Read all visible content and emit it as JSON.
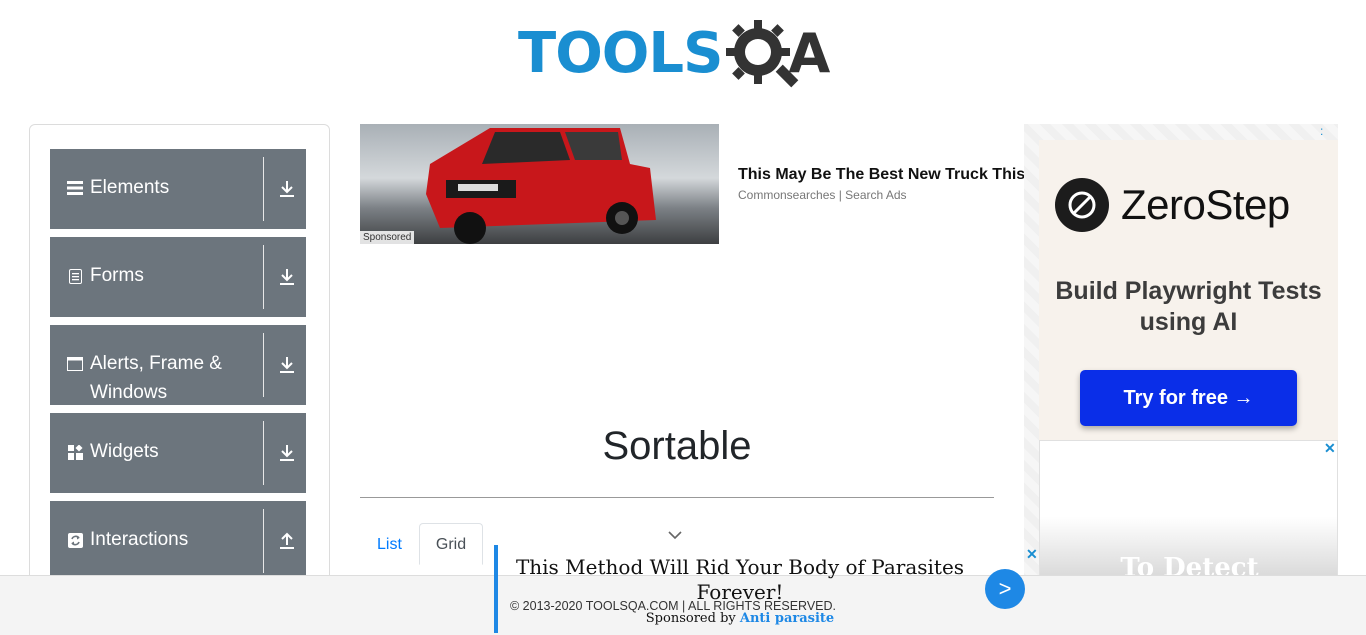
{
  "header": {
    "logo_text_main": "TOOLS",
    "logo_text_end": "A"
  },
  "sidebar": {
    "groups": [
      {
        "label": "Elements",
        "icon": "list-icon",
        "toggle_icon": "download-arrow-icon"
      },
      {
        "label": "Forms",
        "icon": "form-icon",
        "toggle_icon": "download-arrow-icon"
      },
      {
        "label": "Alerts, Frame & Windows",
        "icon": "window-icon",
        "toggle_icon": "download-arrow-icon"
      },
      {
        "label": "Widgets",
        "icon": "widgets-icon",
        "toggle_icon": "download-arrow-icon"
      },
      {
        "label": "Interactions",
        "icon": "interactions-icon",
        "toggle_icon": "upload-arrow-icon"
      }
    ]
  },
  "ad_top": {
    "sponsored_label": "Sponsored",
    "title": "This May Be The Best New Truck This",
    "source": "Commonsearches | Search Ads"
  },
  "ad_right": {
    "brand": "ZeroStep",
    "tagline": "Build Playwright Tests using AI",
    "cta": "Try for free →",
    "corner": ":",
    "box2_text": "To Detect",
    "close": "✕"
  },
  "main": {
    "title": "Sortable",
    "tabs": [
      {
        "label": "List",
        "active": false
      },
      {
        "label": "Grid",
        "active": true
      }
    ]
  },
  "footer": {
    "copyright": "© 2013-2020 TOOLSQA.COM | ALL RIGHTS RESERVED."
  },
  "bottom_ad": {
    "headline": "This Method Will Rid Your Body of Parasites Forever!",
    "sponsor_prefix": "Sponsored by",
    "sponsor_name": "Anti parasite",
    "go_label": ">",
    "close": "✕"
  },
  "colors": {
    "brand_blue": "#1a8ed1",
    "sidebar_bg": "#6c757d",
    "link": "#007bff",
    "cta_blue": "#0a2ee8"
  }
}
